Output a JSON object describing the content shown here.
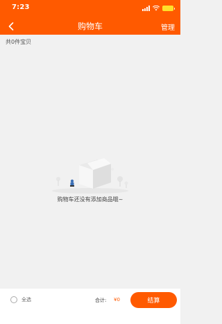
{
  "status_bar": {
    "time": "7:23"
  },
  "header": {
    "title": "购物车",
    "manage_label": "管理",
    "background": "#ff5a00"
  },
  "cart": {
    "item_count_text": "共0件宝贝",
    "empty_message": "购物车还没有添加商品哦~"
  },
  "footer": {
    "select_all_label": "全选",
    "total_label": "合计:",
    "total_value": "¥0",
    "checkout_label": "结算"
  },
  "icons": {
    "back": "chevron-left-icon",
    "signal": "signal-icon",
    "wifi": "wifi-icon",
    "battery": "battery-icon",
    "empty_cart": "empty-box-illustration"
  },
  "colors": {
    "accent": "#ff5a00",
    "background": "#f1f1f1",
    "battery": "#ffe02a"
  }
}
